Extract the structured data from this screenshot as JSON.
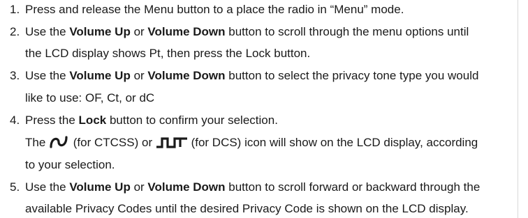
{
  "steps": [
    {
      "number": "1.",
      "lines": [
        [
          "Press and release the Menu button to a place the radio in “Menu” mode."
        ]
      ]
    },
    {
      "number": "2.",
      "lines": [
        [
          "Use the ",
          "Volume Up",
          " or ",
          "Volume Down",
          " button to scroll through the menu options until"
        ],
        [
          "the LCD display shows Pt, then press the Lock button."
        ]
      ]
    },
    {
      "number": "3.",
      "lines": [
        [
          "Use the ",
          "Volume Up",
          " or ",
          "Volume Down",
          " button to select the privacy tone type you would"
        ],
        [
          "like to use: OF, Ct, or dC"
        ]
      ]
    },
    {
      "number": "4.",
      "lines": [
        [
          "Press the ",
          "Lock",
          " button to confirm your selection."
        ],
        [
          "The ",
          "(for CTCSS) or ",
          "(for DCS) icon will show on the LCD display, according"
        ],
        [
          "to your selection."
        ]
      ]
    },
    {
      "number": "5.",
      "lines": [
        [
          "Use the ",
          "Volume Up",
          " or ",
          "Volume Down",
          " button to scroll forward or backward through the"
        ],
        [
          "available Privacy Codes until the desired Privacy Code is shown on the LCD display."
        ]
      ]
    }
  ],
  "icons": {
    "ctcss": "ctcss-wave-icon",
    "dcs": "dcs-square-wave-icon"
  }
}
